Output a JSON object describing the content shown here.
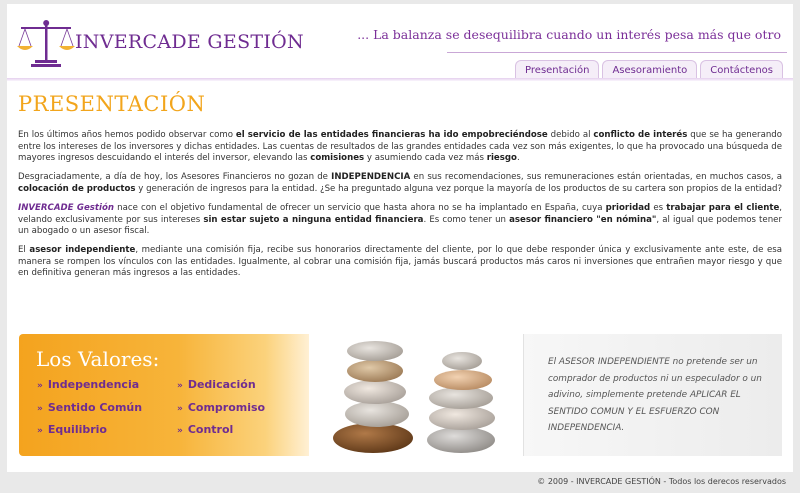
{
  "header": {
    "brand": "INVERCADE GESTIÓN",
    "tagline": "... La balanza se desequilibra cuando un interés pesa más que otro",
    "nav": [
      "Presentación",
      "Asesoramiento",
      "Contáctenos"
    ]
  },
  "main": {
    "title": "PRESENTACIÓN",
    "p1": [
      "En los últimos años hemos podido observar como ",
      "el servicio de las entidades financieras ha ido empobreciéndose",
      " debido al ",
      "conflicto de interés",
      " que se ha generando entre los intereses de los inversores y dichas entidades. Las cuentas de resultados de las grandes entidades cada vez son más exigentes, lo que ha provocado una búsqueda de mayores ingresos descuidando el interés del inversor, elevando las ",
      "comisiones",
      " y asumiendo cada vez más ",
      "riesgo",
      "."
    ],
    "p2": [
      "Desgraciadamente, a día de hoy, los Asesores Financieros no gozan de ",
      "INDEPENDENCIA",
      " en sus recomendaciones, sus remuneraciones están orientadas, en muchos casos, a ",
      "colocación de productos",
      " y generación de ingresos para la entidad. ¿Se ha preguntado alguna vez porque la mayoría de los productos de su cartera son propios de la entidad?"
    ],
    "p3": [
      "INVERCADE Gestión",
      " nace con el objetivo fundamental de ofrecer un servicio que hasta ahora no se ha implantado en España, cuya ",
      "prioridad",
      " es ",
      "trabajar para el cliente",
      ", velando exclusivamente por sus intereses ",
      "sin estar sujeto a ninguna entidad financiera",
      ". Es como tener un ",
      "asesor financiero \"en nómina\"",
      ", al igual que podemos tener un abogado o un asesor fiscal."
    ],
    "p4": [
      "El ",
      "asesor independiente",
      ", mediante una comisión fija, recibe sus honorarios directamente del cliente, por lo que debe responder única y exclusivamente ante este, de esa manera se rompen los vínculos con las entidades. Igualmente, al cobrar una comisión fija, jamás buscará productos más caros ni inversiones que entrañen mayor riesgo y que en definitiva generan más ingresos a las entidades."
    ]
  },
  "valores": {
    "title": "Los Valores:",
    "bullet": "»",
    "items": [
      "Independencia",
      "Dedicación",
      "Sentido Común",
      "Compromiso",
      "Equilibrio",
      "Control"
    ]
  },
  "quote": "El ASESOR INDEPENDIENTE no pretende ser un comprador de productos ni un especulador o un adivino, simplemente pretende APLICAR EL SENTIDO COMUN Y EL ESFUERZO CON INDEPENDENCIA.",
  "footer": "© 2009 - INVERCADE GESTIÓN - Todos los derecos reservados",
  "colors": {
    "purple": "#6f2c91",
    "orange": "#f2a51c",
    "banner_orange": "#f4a31e"
  }
}
